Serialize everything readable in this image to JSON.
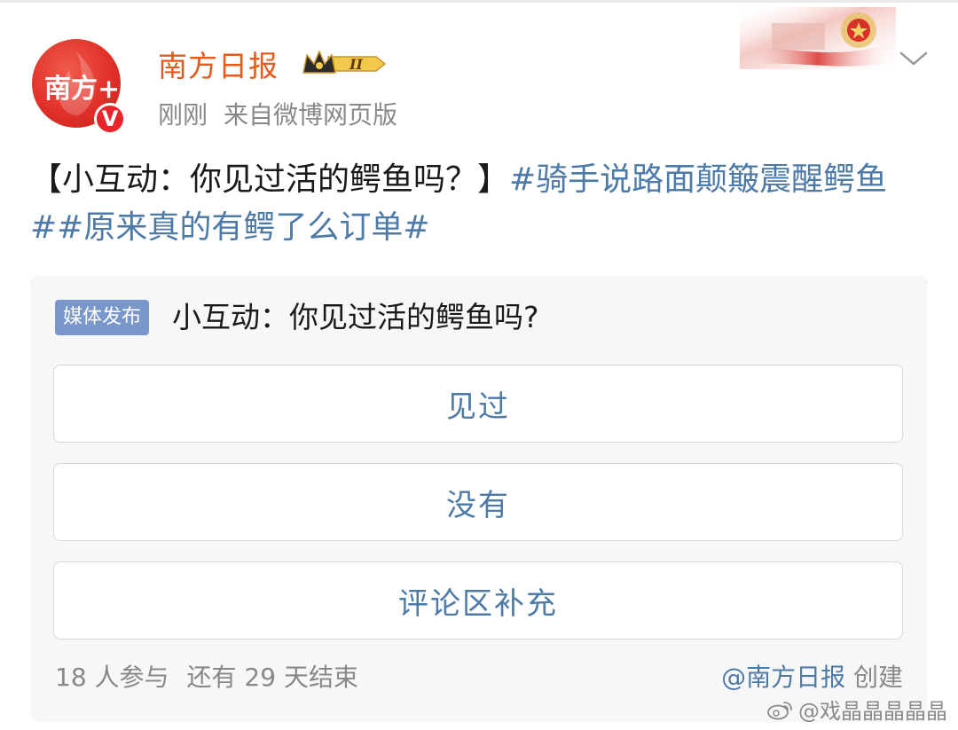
{
  "header": {
    "username": "南方日报",
    "avatar_text": "南方+",
    "verified_badge": "V",
    "level_badge": "II",
    "time": "刚刚",
    "source": "来自微博网页版"
  },
  "post": {
    "title_prefix": "【小互动：你见过活的鳄鱼吗？】",
    "hashtag_1": "#骑手说路面颠簸震醒鳄鱼#",
    "hashtag_2": "#原来真的有鳄了么订单#"
  },
  "poll": {
    "tag": "媒体发布",
    "question": "小互动：你见过活的鳄鱼吗?",
    "options": [
      "见过",
      "没有",
      "评论区补充"
    ],
    "participants": "18 人参与",
    "remaining": "还有 29 天结束",
    "creator": "@南方日报",
    "created_label": "创建"
  },
  "watermark": "@戏晶晶晶晶晶",
  "colors": {
    "username": "#e65a1c",
    "hashtag": "#4e7aa8",
    "tag_bg": "#7a97cb",
    "verified": "#e8252a"
  },
  "icons": {
    "expand": "chevron-down-icon",
    "crown": "crown-level-icon",
    "weibo": "weibo-logo-icon"
  }
}
